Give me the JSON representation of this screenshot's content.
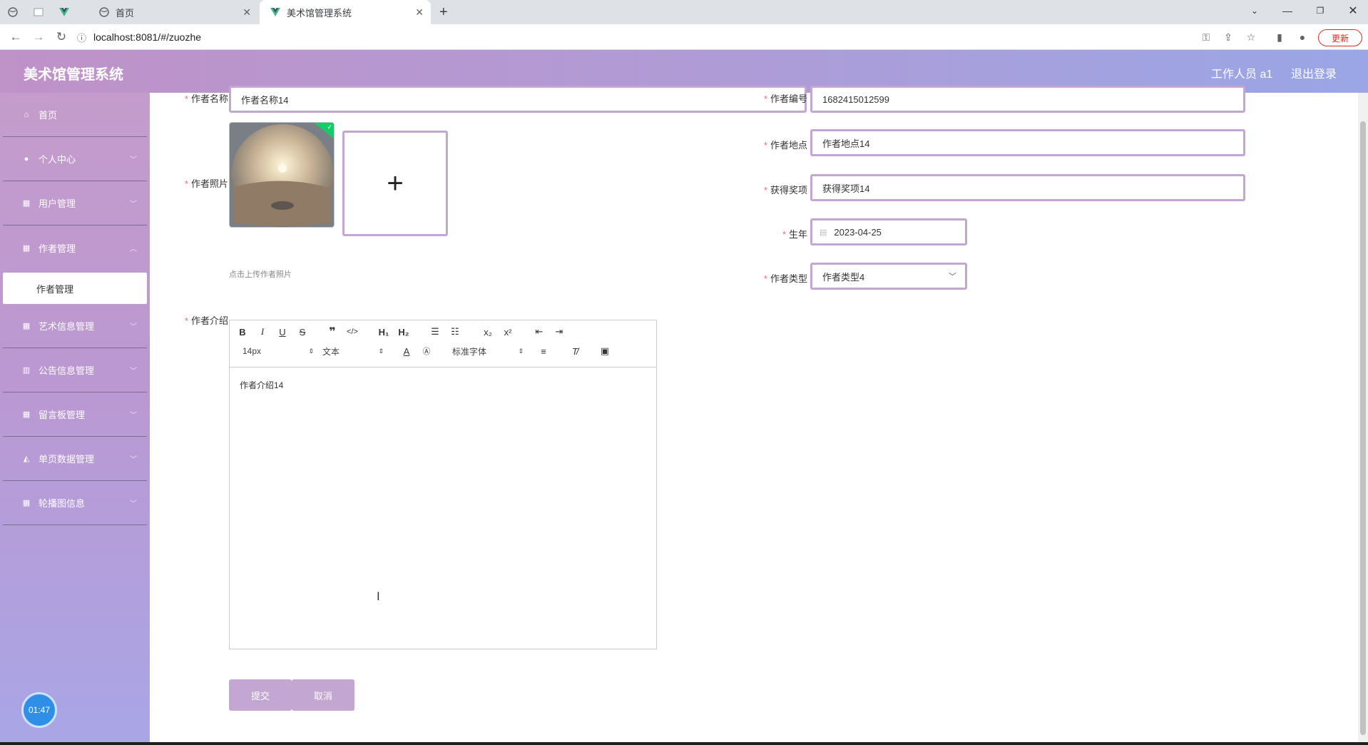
{
  "browser": {
    "tabs": [
      {
        "label": ""
      },
      {
        "label": ""
      },
      {
        "label": ""
      },
      {
        "label": "首页"
      },
      {
        "label": "美术馆管理系统"
      }
    ],
    "url": "localhost:8081/#/zuozhe",
    "update_label": "更新"
  },
  "header": {
    "title": "美术馆管理系统",
    "user": "工作人员 a1",
    "logout": "退出登录"
  },
  "sidebar": {
    "items": [
      {
        "label": "首页",
        "icon": "home-icon"
      },
      {
        "label": "个人中心",
        "icon": "user-icon"
      },
      {
        "label": "用户管理",
        "icon": "grid-icon"
      },
      {
        "label": "作者管理",
        "icon": "grid-icon"
      },
      {
        "label": "艺术信息管理",
        "icon": "grid-icon"
      },
      {
        "label": "公告信息管理",
        "icon": "bar-chart-icon"
      },
      {
        "label": "留言板管理",
        "icon": "grid-icon"
      },
      {
        "label": "单页数据管理",
        "icon": "trend-icon"
      },
      {
        "label": "轮播图信息",
        "icon": "grid-icon"
      }
    ],
    "active_sub": "作者管理",
    "clock": "01:47"
  },
  "form": {
    "name_label": "作者名称",
    "name_value": "作者名称14",
    "number_label": "作者编号",
    "number_value": "1682415012599",
    "photo_label": "作者照片",
    "photo_hint": "点击上传作者照片",
    "location_label": "作者地点",
    "location_value": "作者地点14",
    "award_label": "获得奖项",
    "award_value": "获得奖项14",
    "birth_label": "生年",
    "birth_value": "2023-04-25",
    "type_label": "作者类型",
    "type_value": "作者类型4",
    "intro_label": "作者介绍",
    "intro_value": "作者介绍14",
    "editor": {
      "size": "14px",
      "format": "文本",
      "font": "标准字体"
    },
    "submit": "提交",
    "cancel": "取消"
  }
}
